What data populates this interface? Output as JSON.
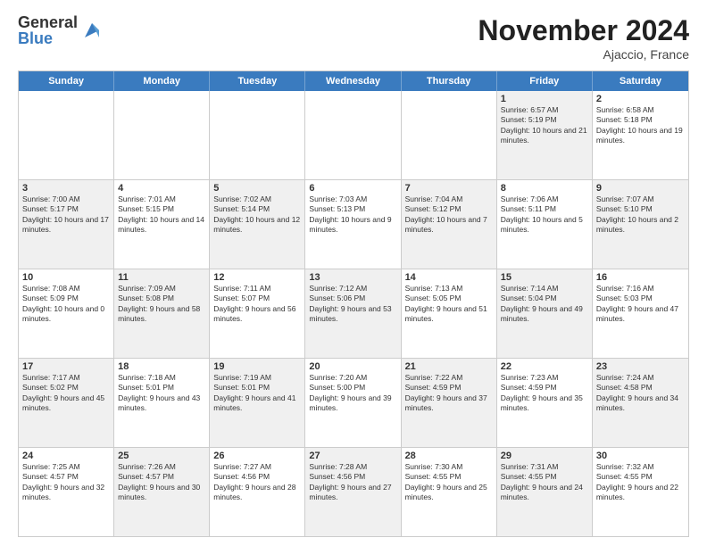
{
  "logo": {
    "general": "General",
    "blue": "Blue"
  },
  "title": "November 2024",
  "location": "Ajaccio, France",
  "header": {
    "days": [
      "Sunday",
      "Monday",
      "Tuesday",
      "Wednesday",
      "Thursday",
      "Friday",
      "Saturday"
    ]
  },
  "rows": [
    [
      {
        "day": "",
        "empty": true,
        "shaded": false
      },
      {
        "day": "",
        "empty": true,
        "shaded": false
      },
      {
        "day": "",
        "empty": true,
        "shaded": false
      },
      {
        "day": "",
        "empty": true,
        "shaded": false
      },
      {
        "day": "",
        "empty": true,
        "shaded": false
      },
      {
        "day": "1",
        "info": "Sunrise: 6:57 AM\nSunset: 5:19 PM\nDaylight: 10 hours and 21 minutes.",
        "shaded": true
      },
      {
        "day": "2",
        "info": "Sunrise: 6:58 AM\nSunset: 5:18 PM\nDaylight: 10 hours and 19 minutes.",
        "shaded": false
      }
    ],
    [
      {
        "day": "3",
        "info": "Sunrise: 7:00 AM\nSunset: 5:17 PM\nDaylight: 10 hours and 17 minutes.",
        "shaded": true
      },
      {
        "day": "4",
        "info": "Sunrise: 7:01 AM\nSunset: 5:15 PM\nDaylight: 10 hours and 14 minutes.",
        "shaded": false
      },
      {
        "day": "5",
        "info": "Sunrise: 7:02 AM\nSunset: 5:14 PM\nDaylight: 10 hours and 12 minutes.",
        "shaded": true
      },
      {
        "day": "6",
        "info": "Sunrise: 7:03 AM\nSunset: 5:13 PM\nDaylight: 10 hours and 9 minutes.",
        "shaded": false
      },
      {
        "day": "7",
        "info": "Sunrise: 7:04 AM\nSunset: 5:12 PM\nDaylight: 10 hours and 7 minutes.",
        "shaded": true
      },
      {
        "day": "8",
        "info": "Sunrise: 7:06 AM\nSunset: 5:11 PM\nDaylight: 10 hours and 5 minutes.",
        "shaded": false
      },
      {
        "day": "9",
        "info": "Sunrise: 7:07 AM\nSunset: 5:10 PM\nDaylight: 10 hours and 2 minutes.",
        "shaded": true
      }
    ],
    [
      {
        "day": "10",
        "info": "Sunrise: 7:08 AM\nSunset: 5:09 PM\nDaylight: 10 hours and 0 minutes.",
        "shaded": false
      },
      {
        "day": "11",
        "info": "Sunrise: 7:09 AM\nSunset: 5:08 PM\nDaylight: 9 hours and 58 minutes.",
        "shaded": true
      },
      {
        "day": "12",
        "info": "Sunrise: 7:11 AM\nSunset: 5:07 PM\nDaylight: 9 hours and 56 minutes.",
        "shaded": false
      },
      {
        "day": "13",
        "info": "Sunrise: 7:12 AM\nSunset: 5:06 PM\nDaylight: 9 hours and 53 minutes.",
        "shaded": true
      },
      {
        "day": "14",
        "info": "Sunrise: 7:13 AM\nSunset: 5:05 PM\nDaylight: 9 hours and 51 minutes.",
        "shaded": false
      },
      {
        "day": "15",
        "info": "Sunrise: 7:14 AM\nSunset: 5:04 PM\nDaylight: 9 hours and 49 minutes.",
        "shaded": true
      },
      {
        "day": "16",
        "info": "Sunrise: 7:16 AM\nSunset: 5:03 PM\nDaylight: 9 hours and 47 minutes.",
        "shaded": false
      }
    ],
    [
      {
        "day": "17",
        "info": "Sunrise: 7:17 AM\nSunset: 5:02 PM\nDaylight: 9 hours and 45 minutes.",
        "shaded": true
      },
      {
        "day": "18",
        "info": "Sunrise: 7:18 AM\nSunset: 5:01 PM\nDaylight: 9 hours and 43 minutes.",
        "shaded": false
      },
      {
        "day": "19",
        "info": "Sunrise: 7:19 AM\nSunset: 5:01 PM\nDaylight: 9 hours and 41 minutes.",
        "shaded": true
      },
      {
        "day": "20",
        "info": "Sunrise: 7:20 AM\nSunset: 5:00 PM\nDaylight: 9 hours and 39 minutes.",
        "shaded": false
      },
      {
        "day": "21",
        "info": "Sunrise: 7:22 AM\nSunset: 4:59 PM\nDaylight: 9 hours and 37 minutes.",
        "shaded": true
      },
      {
        "day": "22",
        "info": "Sunrise: 7:23 AM\nSunset: 4:59 PM\nDaylight: 9 hours and 35 minutes.",
        "shaded": false
      },
      {
        "day": "23",
        "info": "Sunrise: 7:24 AM\nSunset: 4:58 PM\nDaylight: 9 hours and 34 minutes.",
        "shaded": true
      }
    ],
    [
      {
        "day": "24",
        "info": "Sunrise: 7:25 AM\nSunset: 4:57 PM\nDaylight: 9 hours and 32 minutes.",
        "shaded": false
      },
      {
        "day": "25",
        "info": "Sunrise: 7:26 AM\nSunset: 4:57 PM\nDaylight: 9 hours and 30 minutes.",
        "shaded": true
      },
      {
        "day": "26",
        "info": "Sunrise: 7:27 AM\nSunset: 4:56 PM\nDaylight: 9 hours and 28 minutes.",
        "shaded": false
      },
      {
        "day": "27",
        "info": "Sunrise: 7:28 AM\nSunset: 4:56 PM\nDaylight: 9 hours and 27 minutes.",
        "shaded": true
      },
      {
        "day": "28",
        "info": "Sunrise: 7:30 AM\nSunset: 4:55 PM\nDaylight: 9 hours and 25 minutes.",
        "shaded": false
      },
      {
        "day": "29",
        "info": "Sunrise: 7:31 AM\nSunset: 4:55 PM\nDaylight: 9 hours and 24 minutes.",
        "shaded": true
      },
      {
        "day": "30",
        "info": "Sunrise: 7:32 AM\nSunset: 4:55 PM\nDaylight: 9 hours and 22 minutes.",
        "shaded": false
      }
    ]
  ]
}
